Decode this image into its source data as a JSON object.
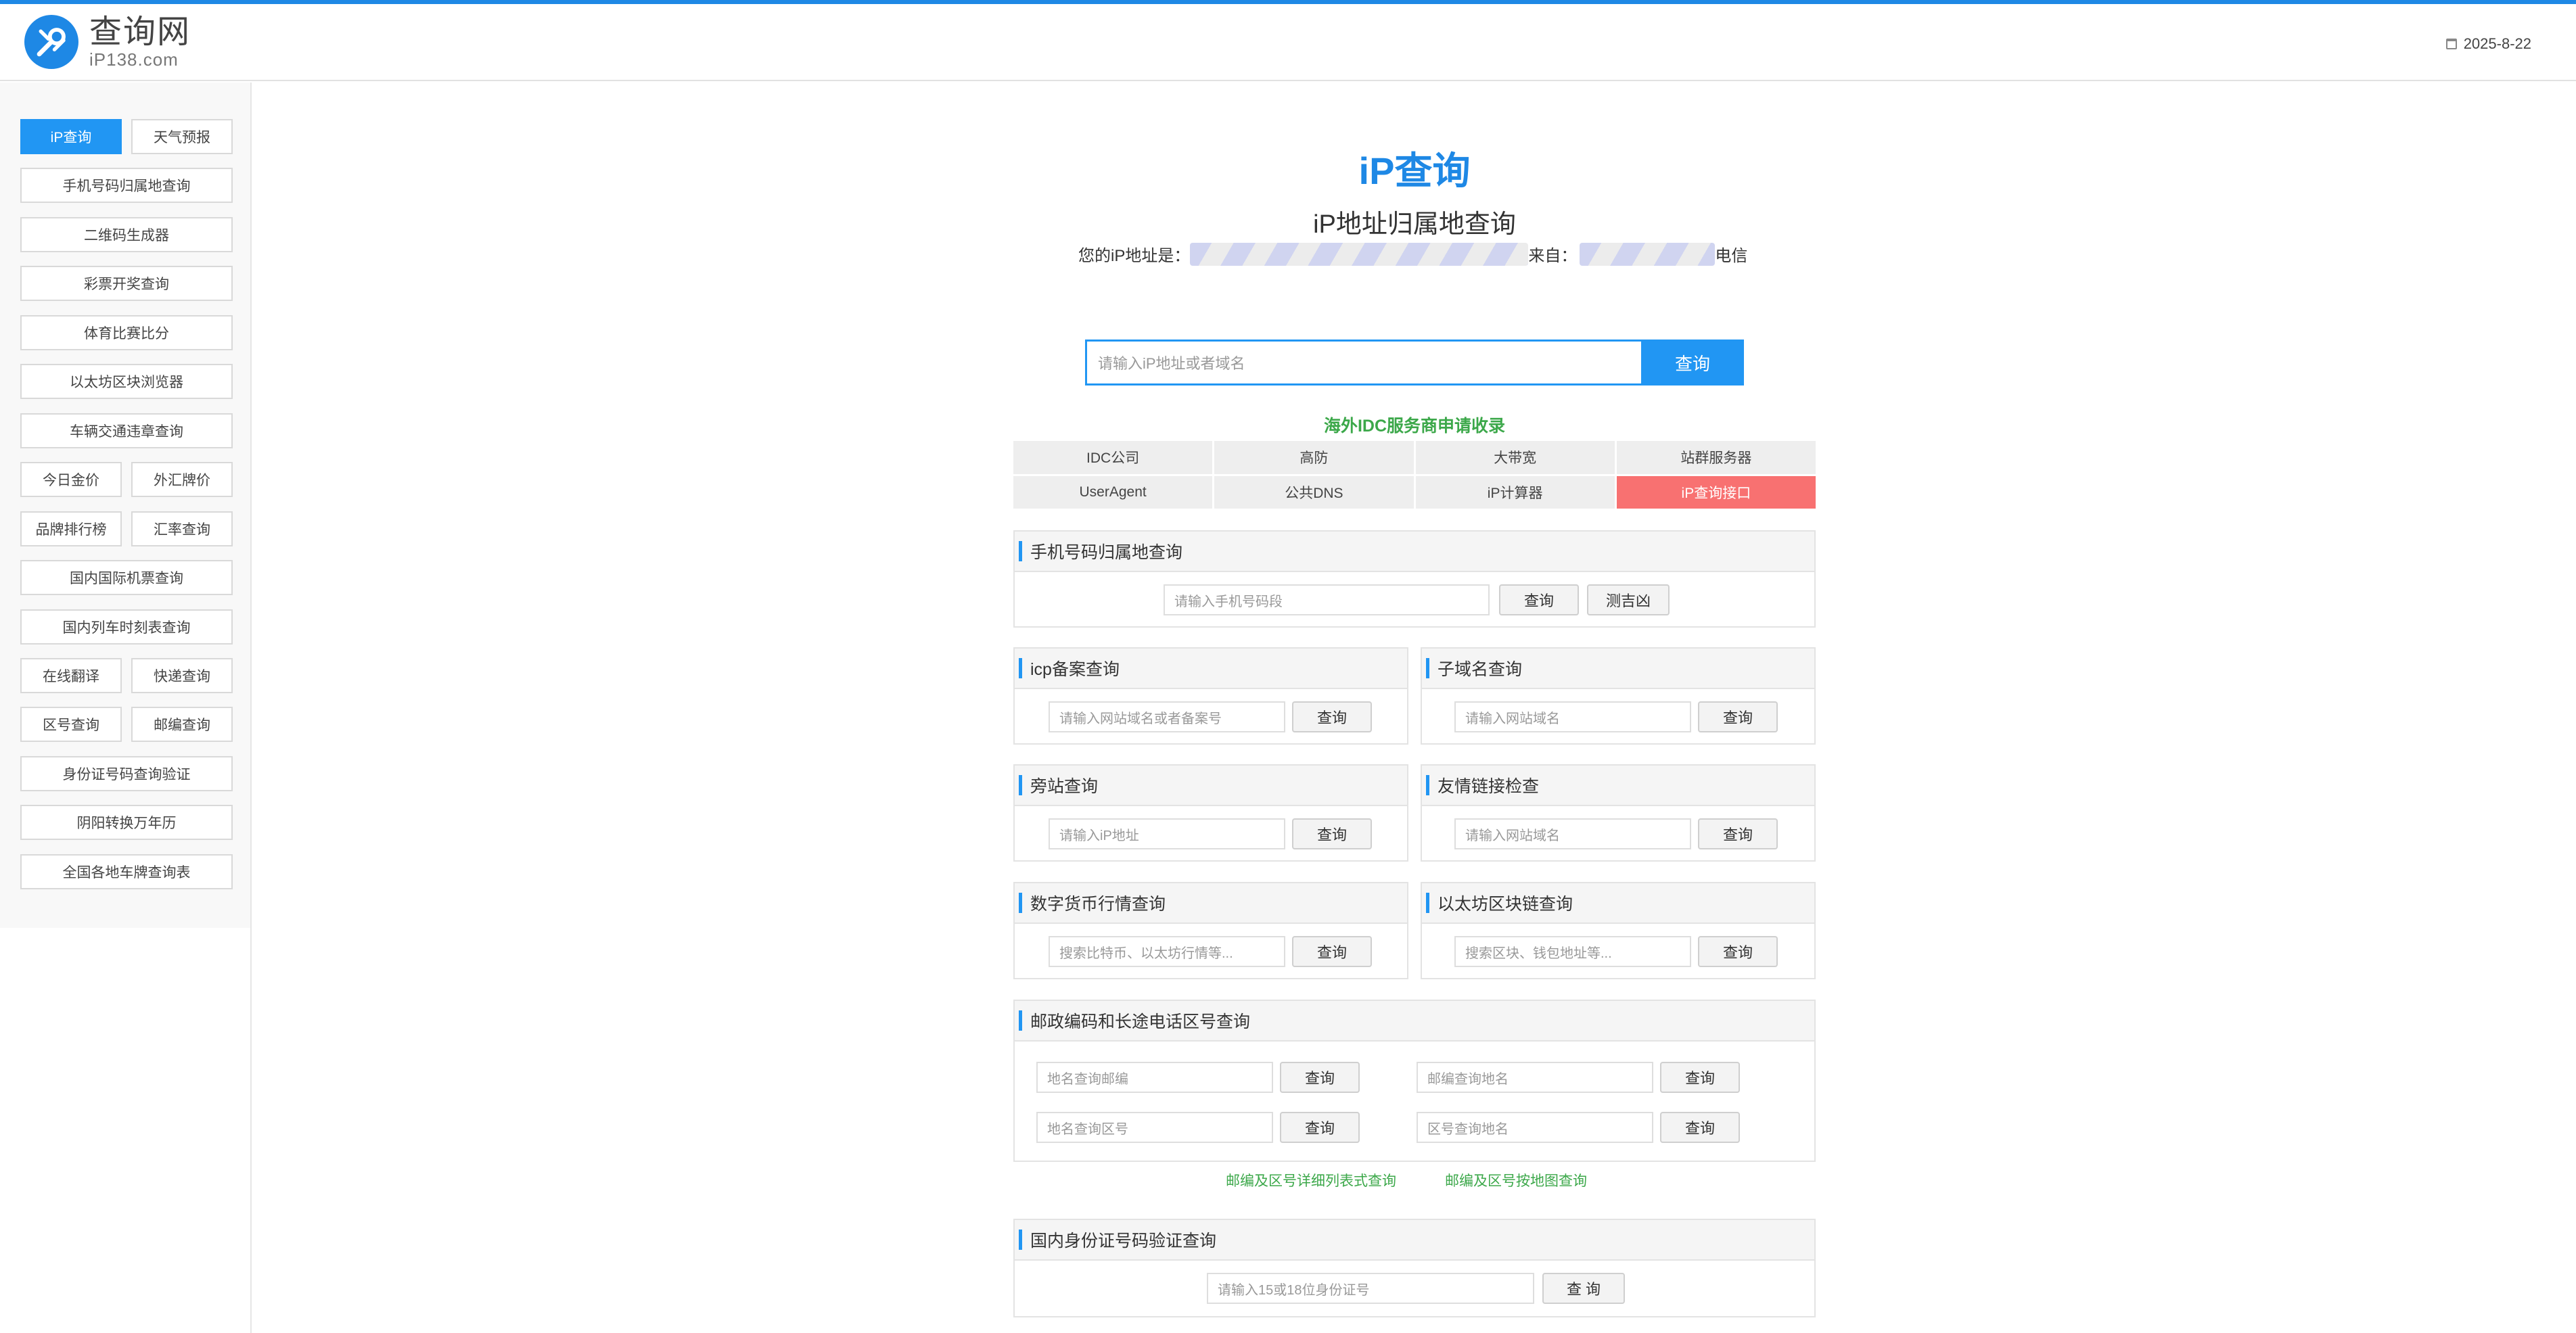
{
  "header": {
    "logo_name": "查询网",
    "logo_domain": "iP138.com",
    "date": "2025-8-22"
  },
  "sidebar": {
    "items": [
      {
        "label": "iP查询",
        "active": true
      },
      {
        "label": "天气预报"
      },
      {
        "label": "手机号码归属地查询"
      },
      {
        "label": "二维码生成器"
      },
      {
        "label": "彩票开奖查询"
      },
      {
        "label": "体育比赛比分"
      },
      {
        "label": "以太坊区块浏览器"
      },
      {
        "label": "车辆交通违章查询"
      },
      {
        "label": "今日金价"
      },
      {
        "label": "外汇牌价"
      },
      {
        "label": "品牌排行榜"
      },
      {
        "label": "汇率查询"
      },
      {
        "label": "国内国际机票查询"
      },
      {
        "label": "国内列车时刻表查询"
      },
      {
        "label": "在线翻译"
      },
      {
        "label": "快递查询"
      },
      {
        "label": "区号查询"
      },
      {
        "label": "邮编查询"
      },
      {
        "label": "身份证号码查询验证"
      },
      {
        "label": "阴阳转换万年历"
      },
      {
        "label": "全国各地车牌查询表"
      }
    ]
  },
  "main": {
    "title": "iP查询",
    "subtitle": "iP地址归属地查询",
    "my_ip_label": "您的iP地址是：",
    "from_label": "来自：",
    "isp": "电信",
    "search_placeholder": "请输入iP地址或者域名",
    "search_button": "查询",
    "idc_title": "海外IDC服务商申请收录",
    "idc_links": [
      "IDC公司",
      "高防",
      "大带宽",
      "站群服务器",
      "UserAgent",
      "公共DNS",
      "iP计算器",
      "iP查询接口"
    ]
  },
  "panels": {
    "phone": {
      "title": "手机号码归属地查询",
      "placeholder": "请输入手机号码段",
      "button": "查询",
      "button2": "测吉凶"
    },
    "icp": {
      "title": "icp备案查询",
      "placeholder": "请输入网站域名或者备案号",
      "button": "查询"
    },
    "subdomain": {
      "title": "子域名查询",
      "placeholder": "请输入网站域名",
      "button": "查询"
    },
    "sameip": {
      "title": "旁站查询",
      "placeholder": "请输入iP地址",
      "button": "查询"
    },
    "friendlink": {
      "title": "友情链接检查",
      "placeholder": "请输入网站域名",
      "button": "查询"
    },
    "crypto": {
      "title": "数字货币行情查询",
      "placeholder": "搜索比特币、以太坊行情等...",
      "button": "查询"
    },
    "eth": {
      "title": "以太坊区块链查询",
      "placeholder": "搜索区块、钱包地址等...",
      "button": "查询"
    },
    "postal": {
      "title": "邮政编码和长途电话区号查询",
      "f1": "地名查询邮编",
      "f2": "邮编查询地名",
      "f3": "地名查询区号",
      "f4": "区号查询地名",
      "button": "查询",
      "link1": "邮编及区号详细列表式查询",
      "link2": "邮编及区号按地图查询"
    },
    "idcard": {
      "title": "国内身份证号码验证查询",
      "placeholder": "请输入15或18位身份证号",
      "button": "查 询"
    }
  },
  "colors": {
    "accent": "#2196f3",
    "green": "#3ca84a",
    "hot": "#f87171"
  }
}
